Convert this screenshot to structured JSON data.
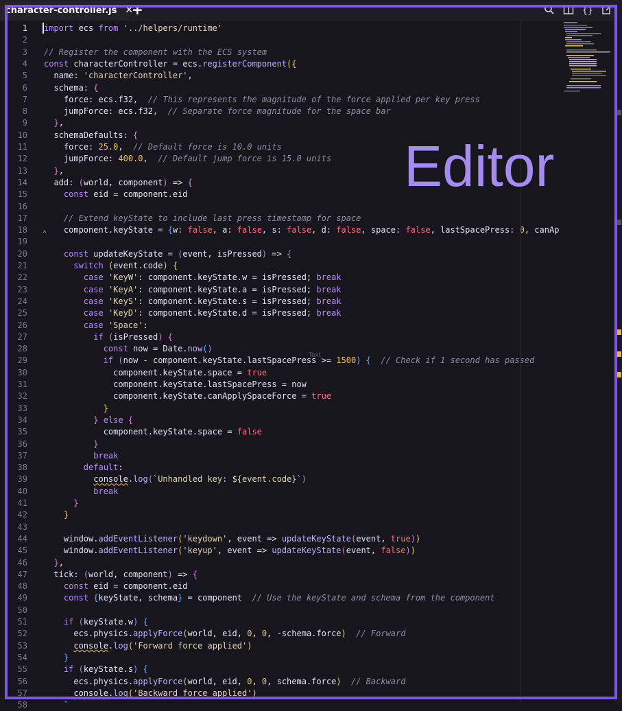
{
  "tab": {
    "title": "character-controller.js",
    "close": "✕",
    "add": "+"
  },
  "toolbar": {
    "icons": [
      "search-icon",
      "split-editor-icon",
      "braces-icon",
      "open-external-icon"
    ]
  },
  "overlay": {
    "label": "Editor",
    "ghost_text": "Text"
  },
  "colors": {
    "background": "#17161c",
    "accent": "#7e57e6",
    "keyword": "#b98cff",
    "string": "#e2d5b6",
    "comment": "#8f8ca6",
    "number": "#f2c55a",
    "boolean": "#ff6b81",
    "property": "#e6e3ef",
    "function": "#bfb0ff",
    "bracket": "#f2d060",
    "bracket2": "#d87ae0",
    "bracket3": "#6aa7ff"
  },
  "editor": {
    "active_line": 1,
    "lines": [
      [
        [
          "k",
          "import"
        ],
        [
          "p",
          " ecs "
        ],
        [
          "k",
          "from"
        ],
        [
          "p",
          " "
        ],
        [
          "s",
          "'../helpers/runtime'"
        ]
      ],
      [],
      [
        [
          "c",
          "// Register the component with the ECS system"
        ]
      ],
      [
        [
          "k",
          "const"
        ],
        [
          "p",
          " characterController = ecs."
        ],
        [
          "f",
          "registerComponent"
        ],
        [
          "b",
          "({"
        ]
      ],
      [
        [
          "p",
          "  name: "
        ],
        [
          "s",
          "'characterController'"
        ],
        [
          "p",
          ","
        ]
      ],
      [
        [
          "p",
          "  schema: "
        ],
        [
          "b2",
          "{"
        ]
      ],
      [
        [
          "p",
          "    force: ecs.f32,  "
        ],
        [
          "c",
          "// This represents the magnitude of the force applied per key press"
        ]
      ],
      [
        [
          "p",
          "    jumpForce: ecs.f32,  "
        ],
        [
          "c",
          "// Separate force magnitude for the space bar"
        ]
      ],
      [
        [
          "p",
          "  "
        ],
        [
          "b2",
          "}"
        ],
        [
          "p",
          ","
        ]
      ],
      [
        [
          "p",
          "  schemaDefaults: "
        ],
        [
          "b2",
          "{"
        ]
      ],
      [
        [
          "p",
          "    force: "
        ],
        [
          "n",
          "25.0"
        ],
        [
          "p",
          ",  "
        ],
        [
          "c",
          "// Default force is 10.0 units"
        ]
      ],
      [
        [
          "p",
          "    jumpForce: "
        ],
        [
          "n",
          "400.0"
        ],
        [
          "p",
          ",  "
        ],
        [
          "c",
          "// Default jump force is 15.0 units"
        ]
      ],
      [
        [
          "p",
          "  "
        ],
        [
          "b2",
          "}"
        ],
        [
          "p",
          ","
        ]
      ],
      [
        [
          "p",
          "  add: "
        ],
        [
          "b2",
          "("
        ],
        [
          "p",
          "world, component"
        ],
        [
          "b2",
          ")"
        ],
        [
          "p",
          " => "
        ],
        [
          "b2",
          "{"
        ]
      ],
      [
        [
          "p",
          "    "
        ],
        [
          "k",
          "const"
        ],
        [
          "p",
          " eid = component.eid"
        ]
      ],
      [],
      [
        [
          "p",
          "    "
        ],
        [
          "c",
          "// Extend keyState to include last press timestamp for space"
        ]
      ],
      [
        [
          "p",
          "    component.keyState = "
        ],
        [
          "b3",
          "{"
        ],
        [
          "p",
          "w: "
        ],
        [
          "t",
          "false"
        ],
        [
          "p",
          ", a: "
        ],
        [
          "t",
          "false"
        ],
        [
          "p",
          ", s: "
        ],
        [
          "t",
          "false"
        ],
        [
          "p",
          ", d: "
        ],
        [
          "t",
          "false"
        ],
        [
          "p",
          ", space: "
        ],
        [
          "t",
          "false"
        ],
        [
          "p",
          ", lastSpacePress: "
        ],
        [
          "n",
          "0"
        ],
        [
          "p",
          ", canApplySp"
        ]
      ],
      [],
      [
        [
          "p",
          "    "
        ],
        [
          "k",
          "const"
        ],
        [
          "p",
          " updateKeyState = "
        ],
        [
          "b3",
          "("
        ],
        [
          "p",
          "event, isPressed"
        ],
        [
          "b3",
          ")"
        ],
        [
          "p",
          " => "
        ],
        [
          "b3",
          "{"
        ]
      ],
      [
        [
          "p",
          "      "
        ],
        [
          "k",
          "switch"
        ],
        [
          "p",
          " "
        ],
        [
          "b",
          "("
        ],
        [
          "p",
          "event.code"
        ],
        [
          "b",
          ")"
        ],
        [
          "p",
          " "
        ],
        [
          "b",
          "{"
        ]
      ],
      [
        [
          "p",
          "        "
        ],
        [
          "k",
          "case"
        ],
        [
          "p",
          " "
        ],
        [
          "s",
          "'KeyW'"
        ],
        [
          "p",
          ": component.keyState.w = isPressed; "
        ],
        [
          "k",
          "break"
        ]
      ],
      [
        [
          "p",
          "        "
        ],
        [
          "k",
          "case"
        ],
        [
          "p",
          " "
        ],
        [
          "s",
          "'KeyA'"
        ],
        [
          "p",
          ": component.keyState.a = isPressed; "
        ],
        [
          "k",
          "break"
        ]
      ],
      [
        [
          "p",
          "        "
        ],
        [
          "k",
          "case"
        ],
        [
          "p",
          " "
        ],
        [
          "s",
          "'KeyS'"
        ],
        [
          "p",
          ": component.keyState.s = isPressed; "
        ],
        [
          "k",
          "break"
        ]
      ],
      [
        [
          "p",
          "        "
        ],
        [
          "k",
          "case"
        ],
        [
          "p",
          " "
        ],
        [
          "s",
          "'KeyD'"
        ],
        [
          "p",
          ": component.keyState.d = isPressed; "
        ],
        [
          "k",
          "break"
        ]
      ],
      [
        [
          "p",
          "        "
        ],
        [
          "k",
          "case"
        ],
        [
          "p",
          " "
        ],
        [
          "s",
          "'Space'"
        ],
        [
          "p",
          ":"
        ]
      ],
      [
        [
          "p",
          "          "
        ],
        [
          "k",
          "if"
        ],
        [
          "p",
          " "
        ],
        [
          "b2",
          "("
        ],
        [
          "p",
          "isPressed"
        ],
        [
          "b2",
          ")"
        ],
        [
          "p",
          " "
        ],
        [
          "b2",
          "{"
        ]
      ],
      [
        [
          "p",
          "            "
        ],
        [
          "k",
          "const"
        ],
        [
          "p",
          " now = Date."
        ],
        [
          "f",
          "now"
        ],
        [
          "b3",
          "()"
        ]
      ],
      [
        [
          "p",
          "            "
        ],
        [
          "k",
          "if"
        ],
        [
          "p",
          " "
        ],
        [
          "b3",
          "("
        ],
        [
          "p",
          "now - component.keyState.lastSpacePress >= "
        ],
        [
          "n",
          "1500"
        ],
        [
          "b3",
          ")"
        ],
        [
          "p",
          " "
        ],
        [
          "b3",
          "{"
        ],
        [
          "p",
          "  "
        ],
        [
          "c",
          "// Check if 1 second has passed"
        ]
      ],
      [
        [
          "p",
          "              component.keyState.space = "
        ],
        [
          "t",
          "true"
        ]
      ],
      [
        [
          "p",
          "              component.keyState.lastSpacePress = now"
        ]
      ],
      [
        [
          "p",
          "              component.keyState.canApplySpaceForce = "
        ],
        [
          "t",
          "true"
        ]
      ],
      [
        [
          "p",
          "            "
        ],
        [
          "b",
          "}"
        ]
      ],
      [
        [
          "p",
          "          "
        ],
        [
          "b2",
          "}"
        ],
        [
          "p",
          " "
        ],
        [
          "k",
          "else"
        ],
        [
          "p",
          " "
        ],
        [
          "b2",
          "{"
        ]
      ],
      [
        [
          "p",
          "            component.keyState.space = "
        ],
        [
          "t",
          "false"
        ]
      ],
      [
        [
          "p",
          "          "
        ],
        [
          "b2",
          "}"
        ]
      ],
      [
        [
          "p",
          "          "
        ],
        [
          "k",
          "break"
        ]
      ],
      [
        [
          "p",
          "        "
        ],
        [
          "k",
          "default"
        ],
        [
          "p",
          ":"
        ]
      ],
      [
        [
          "p",
          "          "
        ],
        [
          "u",
          "console"
        ],
        [
          "p",
          "."
        ],
        [
          "f",
          "log"
        ],
        [
          "b3",
          "("
        ],
        [
          "s",
          "`Unhandled key: ${event.code}`"
        ],
        [
          "b3",
          ")"
        ]
      ],
      [
        [
          "p",
          "          "
        ],
        [
          "k",
          "break"
        ]
      ],
      [
        [
          "p",
          "      "
        ],
        [
          "b2",
          "}"
        ]
      ],
      [
        [
          "p",
          "    "
        ],
        [
          "b",
          "}"
        ]
      ],
      [],
      [
        [
          "p",
          "    window."
        ],
        [
          "f",
          "addEventListener"
        ],
        [
          "b",
          "("
        ],
        [
          "s",
          "'keydown'"
        ],
        [
          "p",
          ", event => "
        ],
        [
          "f",
          "updateKeyState"
        ],
        [
          "b2",
          "("
        ],
        [
          "p",
          "event, "
        ],
        [
          "t",
          "true"
        ],
        [
          "b2",
          ")"
        ],
        [
          "b",
          ")"
        ]
      ],
      [
        [
          "p",
          "    window."
        ],
        [
          "f",
          "addEventListener"
        ],
        [
          "b",
          "("
        ],
        [
          "s",
          "'keyup'"
        ],
        [
          "p",
          ", event => "
        ],
        [
          "f",
          "updateKeyState"
        ],
        [
          "b2",
          "("
        ],
        [
          "p",
          "event, "
        ],
        [
          "t",
          "false"
        ],
        [
          "b2",
          ")"
        ],
        [
          "b",
          ")"
        ]
      ],
      [
        [
          "p",
          "  "
        ],
        [
          "b2",
          "}"
        ],
        [
          "p",
          ","
        ]
      ],
      [
        [
          "p",
          "  tick: "
        ],
        [
          "b2",
          "("
        ],
        [
          "p",
          "world, component"
        ],
        [
          "b2",
          ")"
        ],
        [
          "p",
          " => "
        ],
        [
          "b2",
          "{"
        ]
      ],
      [
        [
          "p",
          "    "
        ],
        [
          "k",
          "const"
        ],
        [
          "p",
          " eid = component.eid"
        ]
      ],
      [
        [
          "p",
          "    "
        ],
        [
          "k",
          "const"
        ],
        [
          "p",
          " "
        ],
        [
          "b3",
          "{"
        ],
        [
          "p",
          "keyState, schema"
        ],
        [
          "b3",
          "}"
        ],
        [
          "p",
          " = component  "
        ],
        [
          "c",
          "// Use the keyState and schema from the component"
        ]
      ],
      [],
      [
        [
          "p",
          "    "
        ],
        [
          "k",
          "if"
        ],
        [
          "p",
          " "
        ],
        [
          "b3",
          "("
        ],
        [
          "p",
          "keyState.w"
        ],
        [
          "b3",
          ")"
        ],
        [
          "p",
          " "
        ],
        [
          "b3",
          "{"
        ]
      ],
      [
        [
          "p",
          "      ecs.physics."
        ],
        [
          "f",
          "applyForce"
        ],
        [
          "b",
          "("
        ],
        [
          "p",
          "world, eid, "
        ],
        [
          "n",
          "0"
        ],
        [
          "p",
          ", "
        ],
        [
          "n",
          "0"
        ],
        [
          "p",
          ", -schema.force"
        ],
        [
          "b",
          ")"
        ],
        [
          "p",
          "  "
        ],
        [
          "c",
          "// Forward"
        ]
      ],
      [
        [
          "p",
          "      "
        ],
        [
          "u",
          "console"
        ],
        [
          "p",
          "."
        ],
        [
          "f",
          "log"
        ],
        [
          "b",
          "("
        ],
        [
          "s",
          "'Forward force applied'"
        ],
        [
          "b",
          ")"
        ]
      ],
      [
        [
          "p",
          "    "
        ],
        [
          "b3",
          "}"
        ]
      ],
      [
        [
          "p",
          "    "
        ],
        [
          "k",
          "if"
        ],
        [
          "p",
          " "
        ],
        [
          "b3",
          "("
        ],
        [
          "p",
          "keyState.s"
        ],
        [
          "b3",
          ")"
        ],
        [
          "p",
          " "
        ],
        [
          "b3",
          "{"
        ]
      ],
      [
        [
          "p",
          "      ecs.physics."
        ],
        [
          "f",
          "applyForce"
        ],
        [
          "b",
          "("
        ],
        [
          "p",
          "world, eid, "
        ],
        [
          "n",
          "0"
        ],
        [
          "p",
          ", "
        ],
        [
          "n",
          "0"
        ],
        [
          "p",
          ", schema.force"
        ],
        [
          "b",
          ")"
        ],
        [
          "p",
          "  "
        ],
        [
          "c",
          "// Backward"
        ]
      ],
      [
        [
          "p",
          "      "
        ],
        [
          "u",
          "console"
        ],
        [
          "p",
          "."
        ],
        [
          "f",
          "log"
        ],
        [
          "b",
          "("
        ],
        [
          "s",
          "'Backward force applied'"
        ],
        [
          "b",
          ")"
        ]
      ],
      [
        [
          "p",
          "    "
        ],
        [
          "b3",
          "}"
        ]
      ]
    ]
  }
}
